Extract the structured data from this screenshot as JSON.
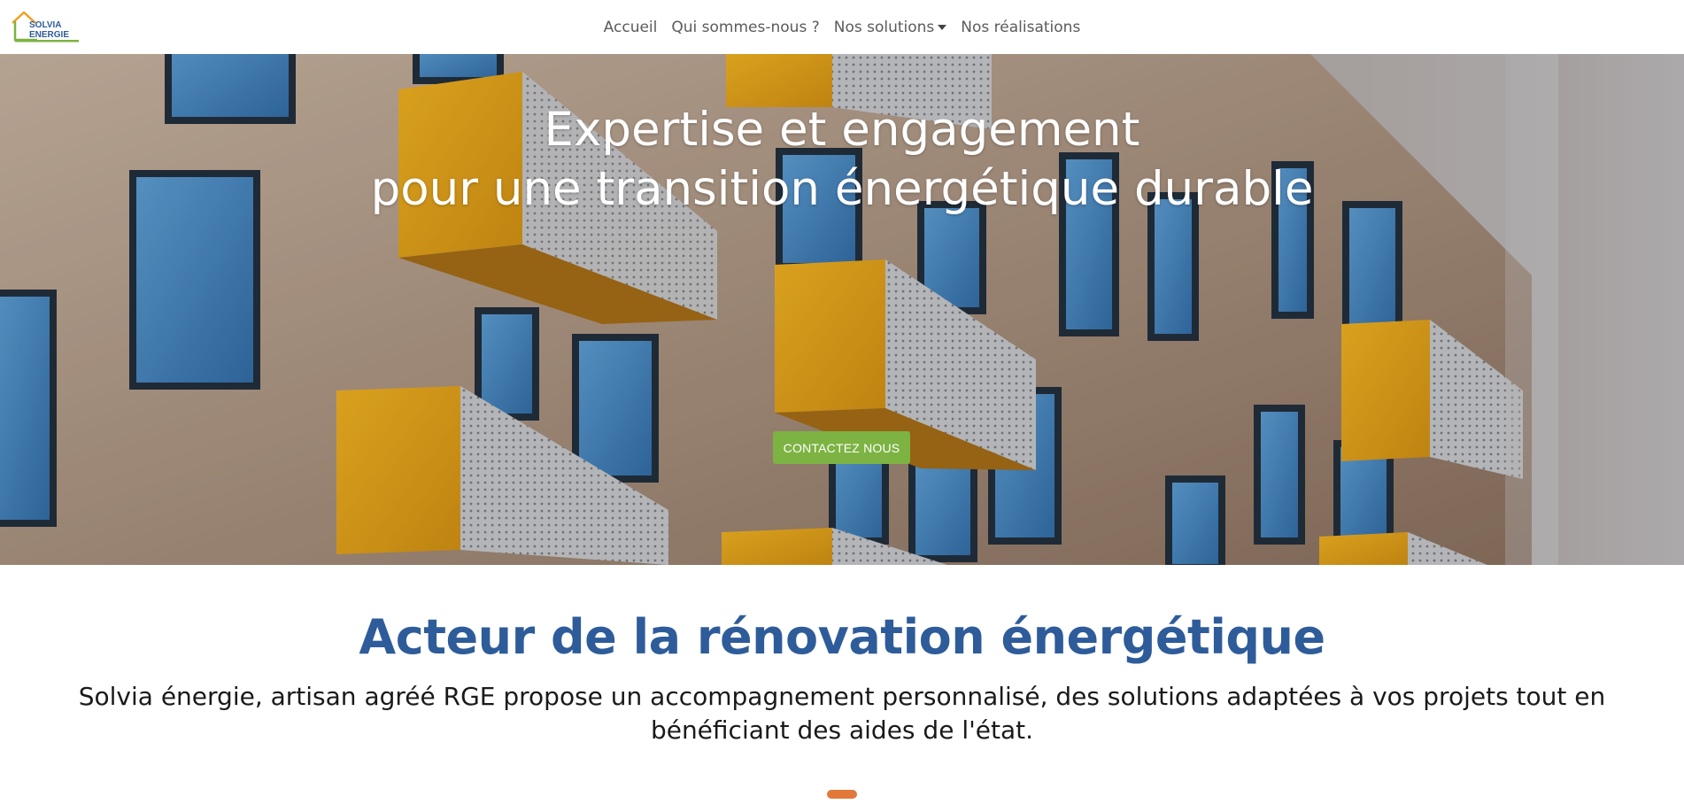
{
  "brand": {
    "logo_line1": "SOLVIA",
    "logo_line2": "ENERGIE",
    "colors": {
      "blue": "#2e5c9a",
      "green": "#7cb342",
      "orange": "#e2793a"
    }
  },
  "nav": {
    "items": [
      {
        "label": "Accueil"
      },
      {
        "label": "Qui sommes-nous ?"
      },
      {
        "label": "Nos solutions",
        "dropdown": true
      },
      {
        "label": "Nos réalisations"
      }
    ]
  },
  "hero": {
    "title_line1": "Expertise et engagement",
    "title_line2": "pour une transition énergétique durable",
    "cta_label": "CONTACTEZ NOUS"
  },
  "intro": {
    "title": "Acteur de la rénovation énergétique",
    "text": "Solvia énergie, artisan agréé RGE propose un accompagnement personnalisé, des solutions adaptées à vos projets tout en bénéficiant des aides de l'état."
  }
}
